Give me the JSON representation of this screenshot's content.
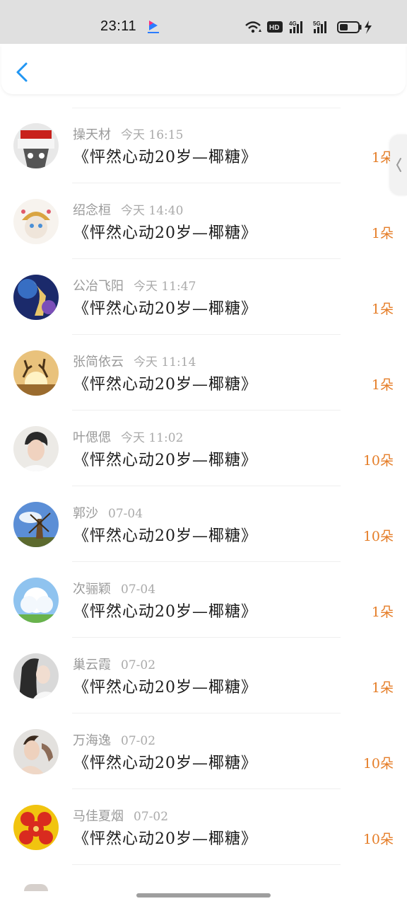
{
  "status_bar": {
    "time": "23:11",
    "icons": [
      "youku-app-icon",
      "wifi-icon",
      "hd-icon",
      "4g-signal-icon",
      "5g-signal-icon",
      "battery-icon",
      "charging-icon"
    ]
  },
  "nav": {
    "back_icon": "chevron-left-icon"
  },
  "records": [
    {
      "name": "操天材",
      "time": "今天 16:15",
      "title": "《怦然心动20岁—椰糖》",
      "amount": "1朵"
    },
    {
      "name": "绍念桓",
      "time": "今天 14:40",
      "title": "《怦然心动20岁—椰糖》",
      "amount": "1朵"
    },
    {
      "name": "公冶飞阳",
      "time": "今天 11:47",
      "title": "《怦然心动20岁—椰糖》",
      "amount": "1朵"
    },
    {
      "name": "张简依云",
      "time": "今天 11:14",
      "title": "《怦然心动20岁—椰糖》",
      "amount": "1朵"
    },
    {
      "name": "叶偲偲",
      "time": "今天 11:02",
      "title": "《怦然心动20岁—椰糖》",
      "amount": "10朵"
    },
    {
      "name": "郭沙",
      "time": "07-04",
      "title": "《怦然心动20岁—椰糖》",
      "amount": "10朵"
    },
    {
      "name": "次骊颖",
      "time": "07-04",
      "title": "《怦然心动20岁—椰糖》",
      "amount": "1朵"
    },
    {
      "name": "巢云霞",
      "time": "07-02",
      "title": "《怦然心动20岁—椰糖》",
      "amount": "1朵"
    },
    {
      "name": "万海逸",
      "time": "07-02",
      "title": "《怦然心动20岁—椰糖》",
      "amount": "10朵"
    },
    {
      "name": "马佳夏烟",
      "time": "07-02",
      "title": "《怦然心动20岁—椰糖》",
      "amount": "10朵"
    }
  ],
  "colors": {
    "amount": "#e57d27",
    "accent": "#2196f3",
    "name": "#9a9a9a",
    "title": "#1c1c1c"
  }
}
